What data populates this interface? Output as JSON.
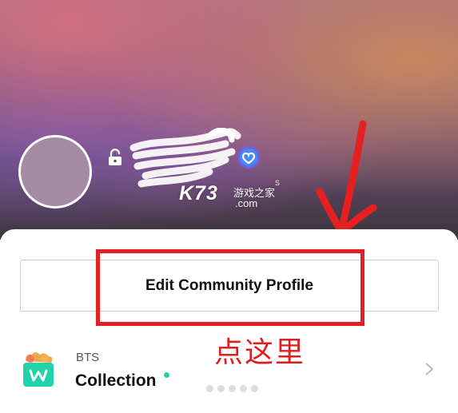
{
  "profile": {
    "verified_badge_icon": "weverse-verified-icon",
    "lock_icon": "unlocked-padlock-icon",
    "avatar_color": "#a48aa3"
  },
  "watermark": {
    "brand": "K73",
    "cn": "游戏之家",
    "domain": ".com",
    "mark": "S"
  },
  "actions": {
    "edit_profile_label": "Edit Community Profile"
  },
  "annotation": {
    "instruction": "点这里",
    "color": "#e62020"
  },
  "collection": {
    "artist": "BTS",
    "title": "Collection",
    "icon": "weverse-shop-bag-icon",
    "new_dot_color": "#21d3a8"
  }
}
